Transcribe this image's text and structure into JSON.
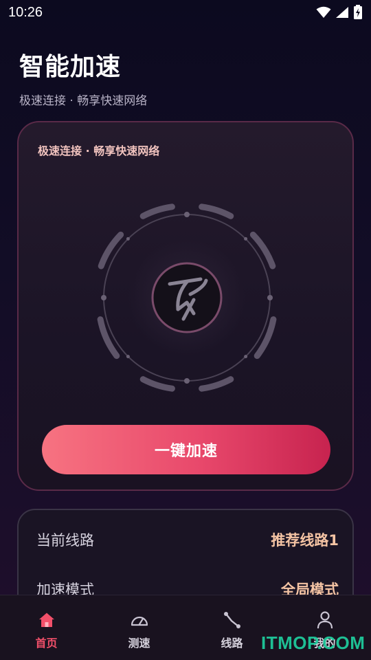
{
  "status_bar": {
    "time": "10:26"
  },
  "header": {
    "title": "智能加速",
    "subtitle": "极速连接 · 畅享快速网络"
  },
  "main_card": {
    "tagline": "极速连接 · 畅享快速网络",
    "boost_button_label": "一键加速"
  },
  "info": {
    "rows": [
      {
        "label": "当前线路",
        "value": "推荐线路1"
      },
      {
        "label": "加速模式",
        "value": "全局模式"
      }
    ]
  },
  "bottom_nav": {
    "items": [
      {
        "label": "首页",
        "icon": "home-icon",
        "active": true
      },
      {
        "label": "测速",
        "icon": "speedometer-icon",
        "active": false
      },
      {
        "label": "线路",
        "icon": "route-icon",
        "active": false
      },
      {
        "label": "我的",
        "icon": "user-icon",
        "active": false
      }
    ]
  },
  "watermark": "ITMOP.COM",
  "colors": {
    "accent": "#f2506a",
    "value_text": "#f5c4a4",
    "button_start": "#f77381",
    "button_end": "#c7234f"
  }
}
